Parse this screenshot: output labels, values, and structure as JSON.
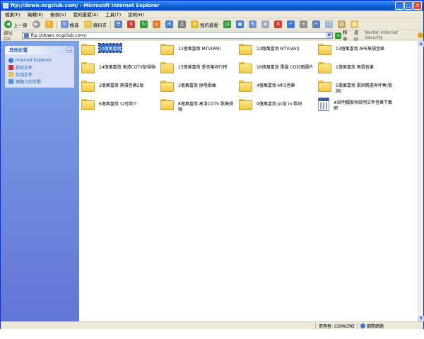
{
  "window": {
    "title": "ftp://down.ncgclub.com/ - Microsoft Internet Explorer",
    "buttons": {
      "minimize": "_",
      "maximize": "□",
      "close": "✕"
    }
  },
  "menu": [
    "檔案(F)",
    "編輯(E)",
    "檢視(V)",
    "我的最愛(A)",
    "工具(T)",
    "說明(H)"
  ],
  "toolbar": {
    "back_label": "上一頁",
    "search_label": "搜尋",
    "folders_label": "資料夾",
    "favorites_label": "我的最愛"
  },
  "address": {
    "label": "網址(D)",
    "value": "ftp://down.ncgclub.com/",
    "go_label": "移至",
    "links_label": "連結",
    "norton_label": "Norton Internet Security"
  },
  "sidebar": {
    "panel_title": "其他位置",
    "items": [
      "Internet Explorer",
      "我的文件",
      "共用文件",
      "網路上的芳鄰"
    ]
  },
  "files": [
    {
      "name": "10億萬富翁",
      "type": "folder",
      "selected": true
    },
    {
      "name": "11億萬富翁 MTV(RM)",
      "type": "folder"
    },
    {
      "name": "12億萬富翁 MTV(AVI)",
      "type": "folder"
    },
    {
      "name": "13億萬富翁 APE無損音樂",
      "type": "folder"
    },
    {
      "name": "14億萬富翁 高清CGTV版視頻",
      "type": "folder"
    },
    {
      "name": "15億萬富翁 愛音樂排行榜",
      "type": "folder"
    },
    {
      "name": "16億萬富翁 電腦 CD封面圖片",
      "type": "folder"
    },
    {
      "name": "1億萬富翁 無損音樂",
      "type": "folder"
    },
    {
      "name": "2億萬富翁 無損音樂2版",
      "type": "folder"
    },
    {
      "name": "3億萬富翁 原唱歌曲",
      "type": "folder"
    },
    {
      "name": "4億萬富翁 MP3音樂",
      "type": "folder"
    },
    {
      "name": "5億萬富翁 歌詞精選與伴奏(歌詞)",
      "type": "folder"
    },
    {
      "name": "6億萬富翁 公司簡介",
      "type": "folder"
    },
    {
      "name": "8億萬富翁 高清CGTV 歌曲視頻",
      "type": "folder"
    },
    {
      "name": "9億萬富翁 pc版 in 歌詞",
      "type": "folder"
    },
    {
      "name": "#說明檔案與說明文件音樂下載網",
      "type": "document"
    }
  ],
  "status": {
    "user": "使用者: COMICME",
    "zone": "網際網路"
  },
  "colors": {
    "titlebar": "#0a5fd6",
    "sidebar": "#7ba2e7",
    "selection": "#316ac5",
    "folder": "#f1c84a"
  }
}
